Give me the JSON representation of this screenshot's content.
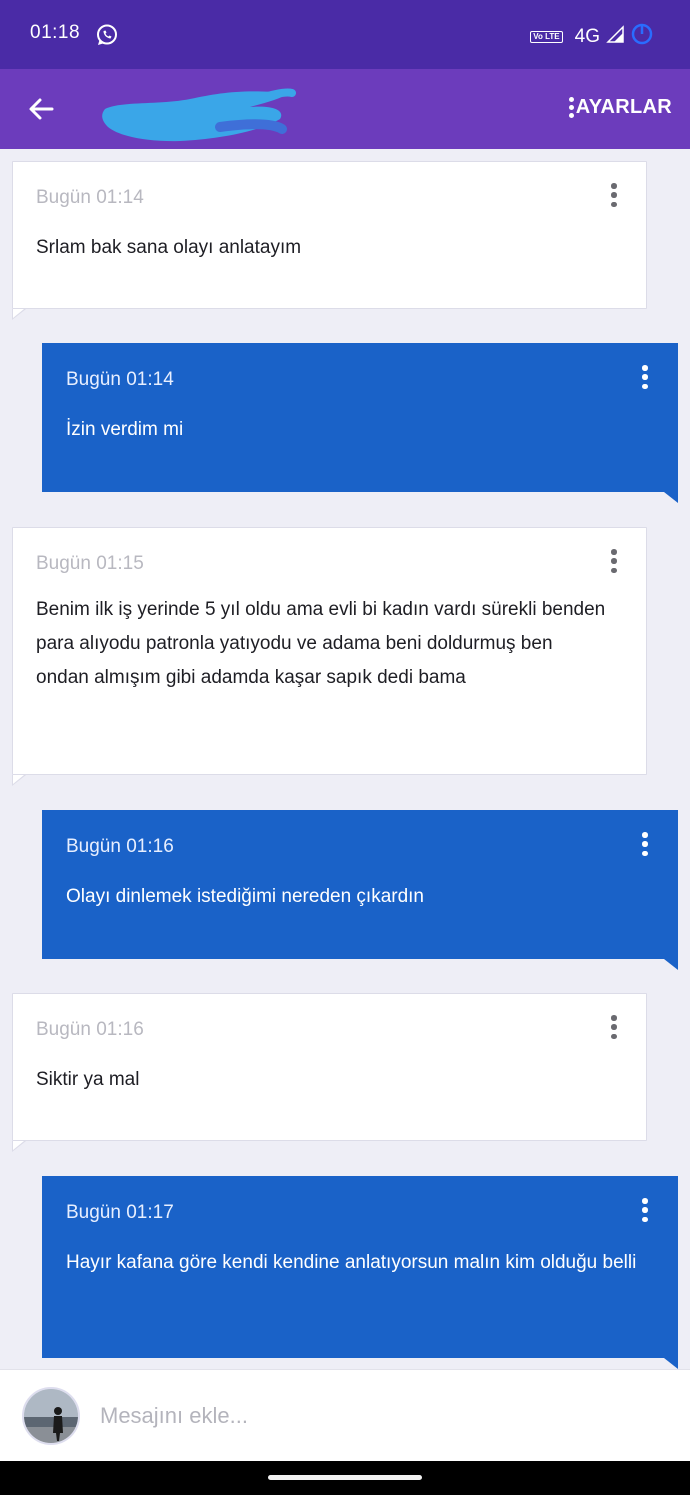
{
  "status_bar": {
    "time": "01:18",
    "volte_badge": "Vo LTE",
    "network": "4G"
  },
  "app_bar": {
    "settings_label": "AYARLAR"
  },
  "messages": [
    {
      "direction": "in",
      "time": "Bugün 01:14",
      "text": "Srlam bak sana olayı anlatayım"
    },
    {
      "direction": "out",
      "time": "Bugün 01:14",
      "text": "İzin verdim mi"
    },
    {
      "direction": "in",
      "time": "Bugün 01:15",
      "text": "Benim ilk iş yerinde 5 yıl oldu ama evli bi kadın vardı sürekli benden para alıyodu patronla yatıyodu ve adama beni doldurmuş ben ondan almışım gibi adamda kaşar sapık dedi bama"
    },
    {
      "direction": "out",
      "time": "Bugün 01:16",
      "text": "Olayı dinlemek istediğimi nereden çıkardın"
    },
    {
      "direction": "in",
      "time": "Bugün 01:16",
      "text": "Siktir ya mal"
    },
    {
      "direction": "out",
      "time": "Bugün 01:17",
      "text": "Hayır kafana göre kendi kendine anlatıyorsun malın kim olduğu belli"
    }
  ],
  "composer": {
    "placeholder": "Mesajını ekle..."
  },
  "colors": {
    "status_bar": "#4a2ba6",
    "app_bar": "#6c3cbc",
    "outgoing_bubble": "#1a62c8",
    "incoming_bubble": "#ffffff",
    "background": "#eeeef6"
  }
}
